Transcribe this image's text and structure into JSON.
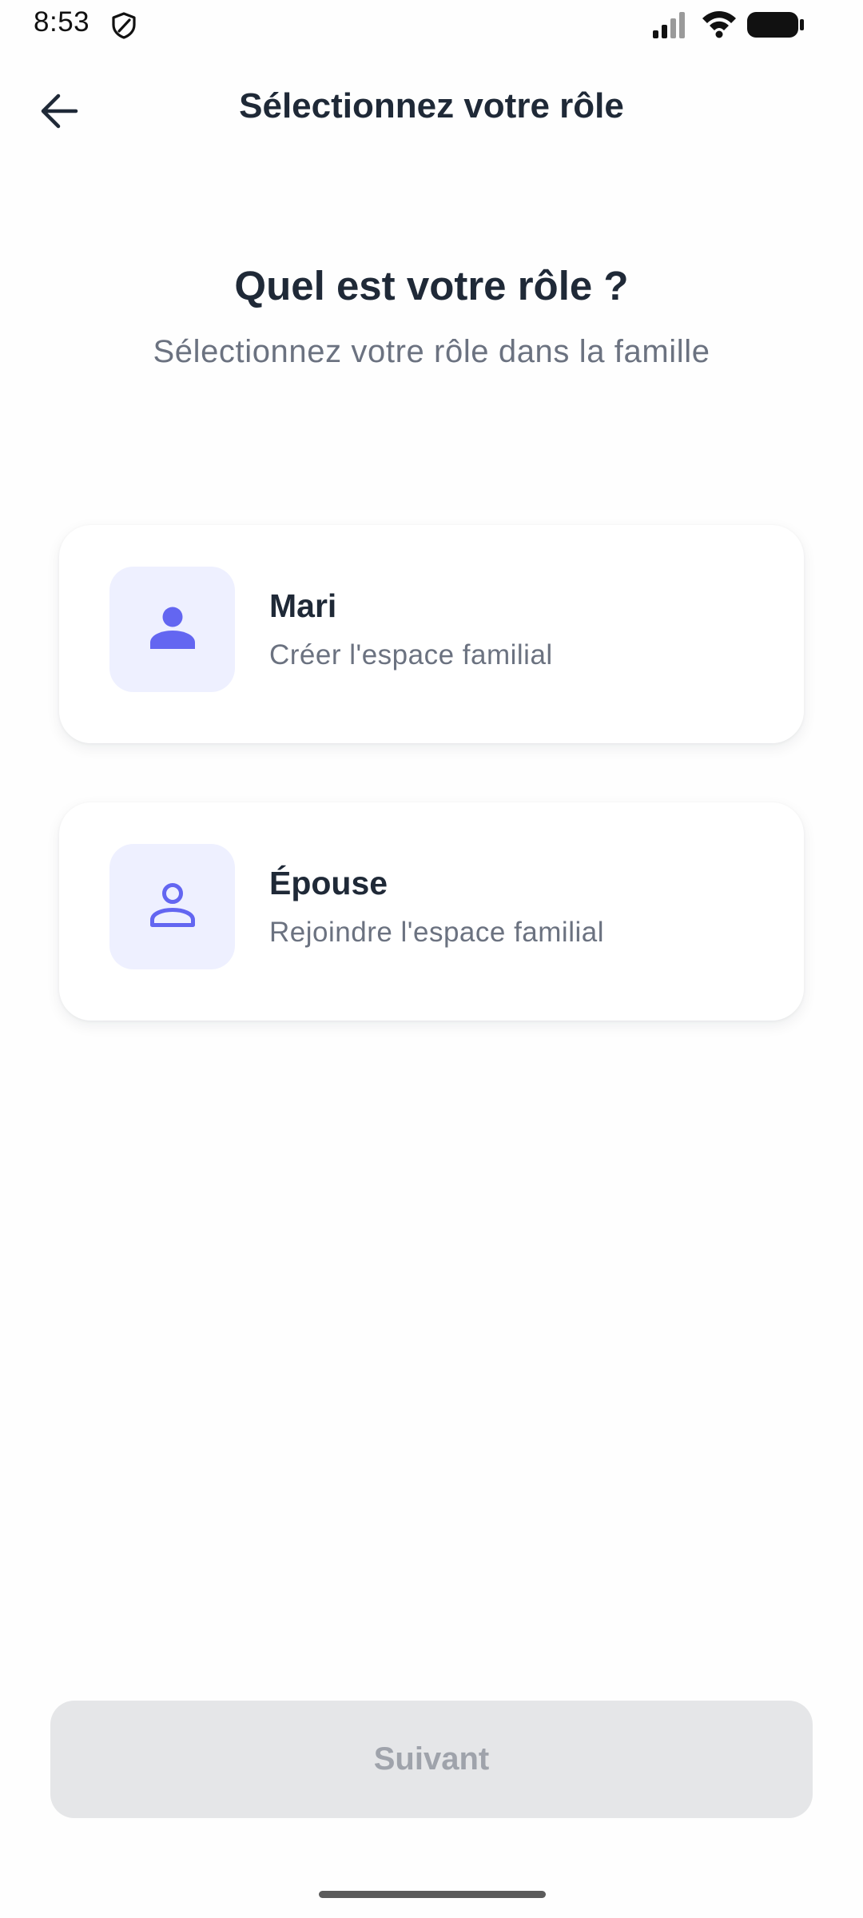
{
  "status_bar": {
    "time": "8:53",
    "icons": [
      "shield-icon",
      "cellular-signal-icon",
      "wifi-icon",
      "battery-icon"
    ]
  },
  "header": {
    "title": "Sélectionnez votre rôle",
    "back_icon": "arrow-left-icon"
  },
  "intro": {
    "heading": "Quel est votre rôle ?",
    "subheading": "Sélectionnez votre rôle dans la famille"
  },
  "roles": [
    {
      "title": "Mari",
      "description": "Créer l'espace familial",
      "icon": "person-filled-icon"
    },
    {
      "title": "Épouse",
      "description": "Rejoindre l'espace familial",
      "icon": "person-outline-icon"
    }
  ],
  "footer": {
    "next_label": "Suivant",
    "next_state": "disabled"
  },
  "colors": {
    "accent": "#6366f1",
    "icon_background": "#eef0ff",
    "title_text": "#1f2937",
    "secondary_text": "#6b7280",
    "button_disabled_bg": "#e5e6e8",
    "button_disabled_text": "#9fa3ab"
  }
}
